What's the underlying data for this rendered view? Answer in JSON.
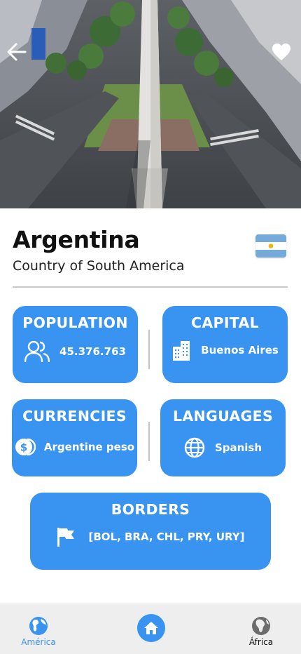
{
  "country": {
    "name": "Argentina",
    "subtitle": "Country of South America",
    "flag_icon": "argentina-flag"
  },
  "header": {
    "back_icon": "arrow-left-icon",
    "favorite_icon": "heart-icon"
  },
  "cards": {
    "population": {
      "title": "POPULATION",
      "value": "45.376.763",
      "icon": "users-icon"
    },
    "capital": {
      "title": "CAPITAL",
      "value": "Buenos Aires",
      "icon": "buildings-icon"
    },
    "currencies": {
      "title": "CURRENCIES",
      "value": "Argentine peso",
      "icon": "dollar-coin-icon"
    },
    "languages": {
      "title": "LANGUAGES",
      "value": "Spanish",
      "icon": "globe-icon"
    },
    "borders": {
      "title": "BORDERS",
      "value": "[BOL, BRA, CHL, PRY, URY]",
      "icon": "flag-icon"
    }
  },
  "nav": {
    "left": {
      "label": "América",
      "icon": "globe-americas-icon"
    },
    "center": {
      "icon": "home-icon"
    },
    "right": {
      "label": "África",
      "icon": "globe-africa-icon"
    }
  },
  "colors": {
    "accent": "#3993f0",
    "nav_bg": "#eeeeee",
    "flag_blue": "#75aadb",
    "flag_sun": "#f6b40e"
  }
}
